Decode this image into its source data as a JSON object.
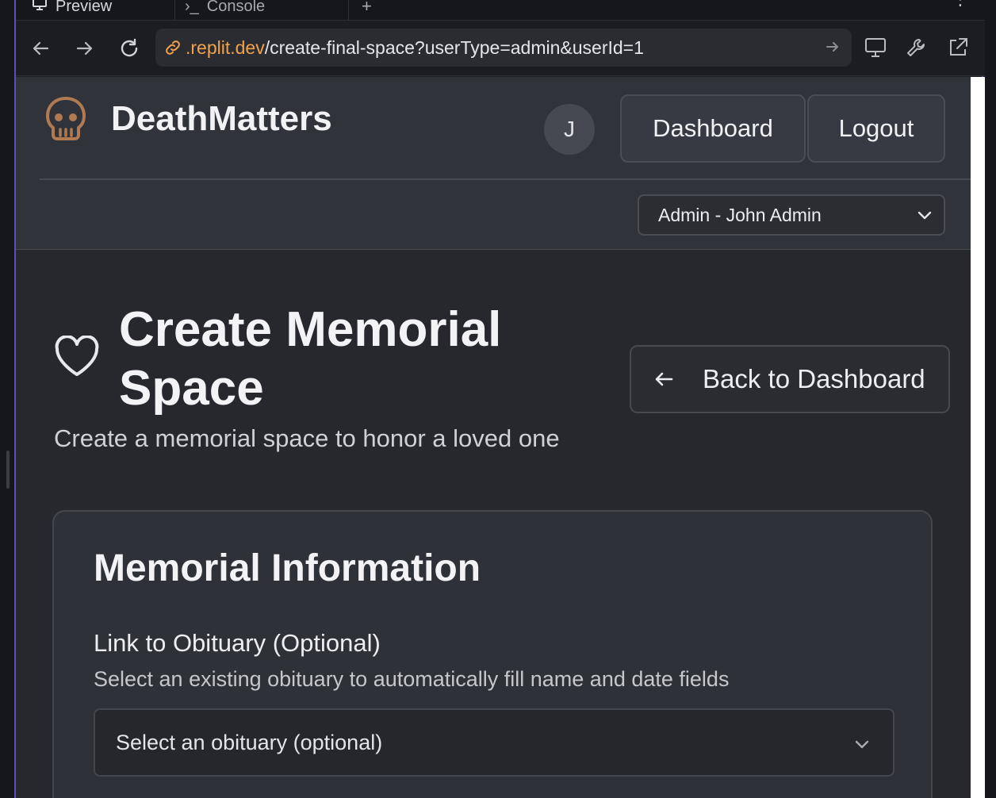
{
  "browser": {
    "tabs": [
      {
        "label": "Preview"
      },
      {
        "label": "Console"
      }
    ],
    "new_tab_label": "+",
    "url": {
      "domain": ".replit.dev",
      "path": "/create-final-space?userType=admin&userId=1"
    }
  },
  "header": {
    "brand": "DeathMatters",
    "avatar_initial": "J",
    "dashboard_label": "Dashboard",
    "logout_label": "Logout",
    "user_select_value": "Admin - John Admin"
  },
  "main": {
    "title": "Create Memorial Space",
    "subtitle": "Create a memorial space to honor a loved one",
    "back_label": "Back to Dashboard"
  },
  "card": {
    "title": "Memorial Information",
    "obituary_label": "Link to Obituary (Optional)",
    "obituary_help": "Select an existing obituary to automatically fill name and date fields",
    "obituary_placeholder": "Select an obituary (optional)"
  },
  "colors": {
    "accent_url": "#f0a24c",
    "logo": "#b07a52",
    "frame": "#5b4fb8"
  }
}
